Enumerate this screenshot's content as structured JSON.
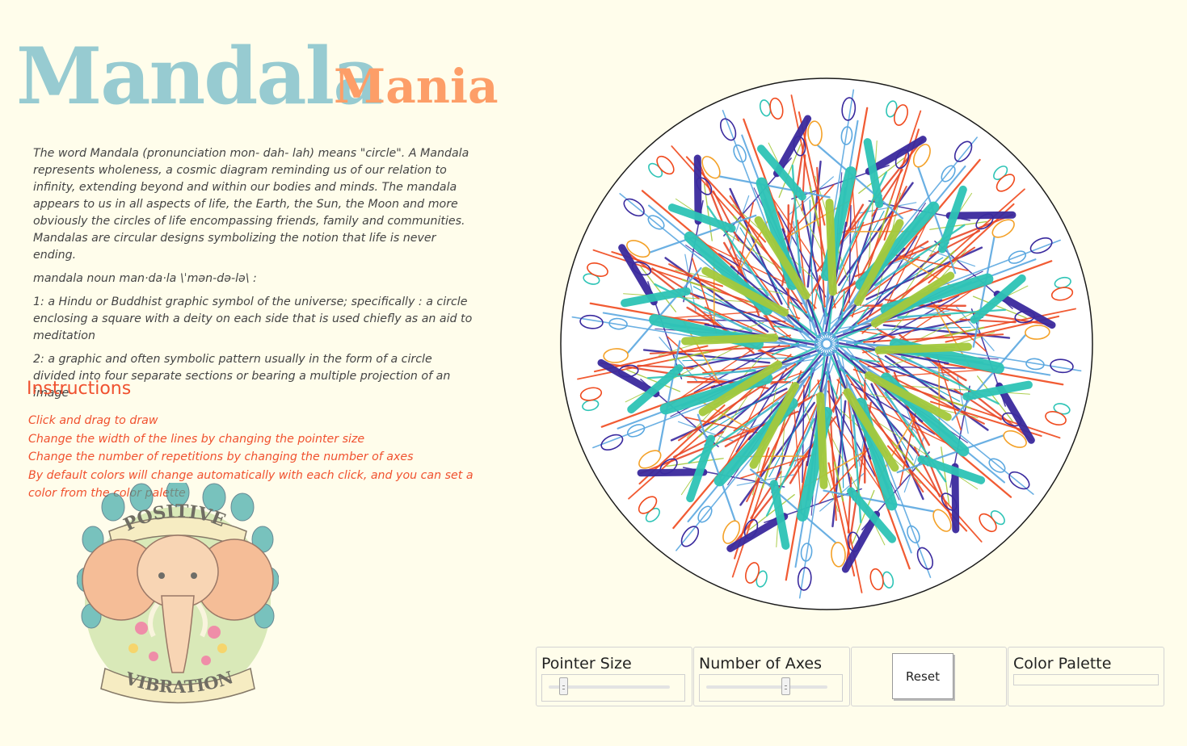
{
  "title": {
    "main": "Mandala",
    "accent": "Mania"
  },
  "intro": {
    "paragraphs": [
      "The word Mandala (pronunciation mon- dah- lah) means \"circle\". A Mandala represents wholeness, a cosmic diagram reminding us of our relation to infinity, extending beyond and within our bodies and minds. The mandala appears to us in all aspects of life, the Earth, the Sun, the Moon and more obviously the circles of life encompassing friends, family and communities. Mandalas are circular designs symbolizing the notion that life is never ending.",
      "mandala noun man·da·la \\ˈmən-də-lə\\ :",
      "1: a Hindu or Buddhist graphic symbol of the universe; specifically : a circle enclosing a square with a deity on each side that is used chiefly as an aid to meditation",
      "2: a graphic and often symbolic pattern usually in the form of a circle divided into four separate sections or bearing a multiple projection of an image"
    ]
  },
  "instructions": {
    "heading": "Instructions",
    "items": [
      "Click and drag to draw",
      "Change the width of the lines by changing the pointer size",
      "Change the number of repetitions by changing the number of axes",
      "By default colors will change automatically with each click, and you can set a color from the color palette"
    ]
  },
  "image": {
    "top_text": "POSITIVE",
    "bottom_text": "VIBRATION"
  },
  "controls": {
    "pointer_size": {
      "label": "Pointer Size",
      "value": 0.12
    },
    "axes": {
      "label": "Number of Axes",
      "value": 0.65
    },
    "reset_label": "Reset",
    "palette_label": "Color Palette"
  },
  "colors": {
    "title_main": "#97cbd1",
    "title_accent": "#fd9e68",
    "instructions": "#f0512f",
    "background": "#fffdeb",
    "mandala_palette": [
      "#2ec4b6",
      "#a4c93c",
      "#3a2a9e",
      "#f04a1e",
      "#f4a127",
      "#5ba8e0",
      "#1aa3c9",
      "#e8492a"
    ]
  }
}
